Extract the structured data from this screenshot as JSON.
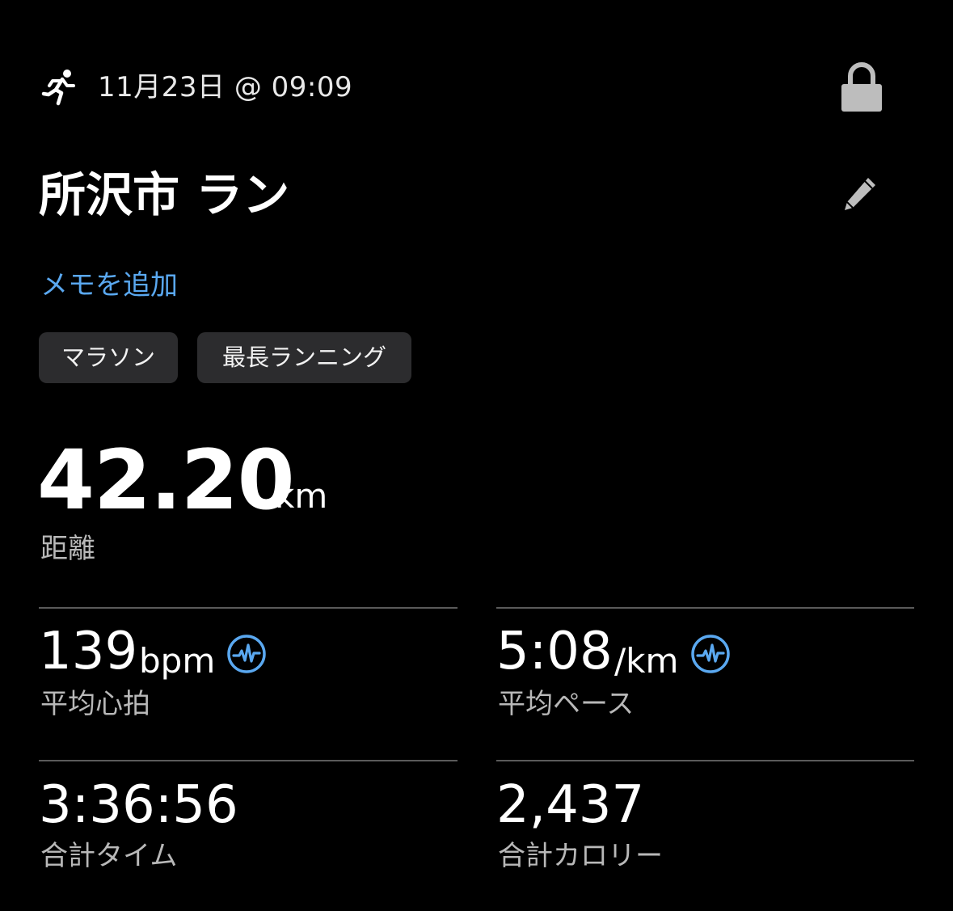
{
  "header": {
    "activity_icon": "running-person-icon",
    "date_time": "11月23日 @ 09:09",
    "privacy_icon": "lock-icon"
  },
  "title": {
    "text": "所沢市 ラン",
    "edit_icon": "pencil-icon"
  },
  "memo": {
    "add_label": "メモを追加"
  },
  "tags": [
    {
      "label": "マラソン"
    },
    {
      "label": "最長ランニング"
    }
  ],
  "distance": {
    "value": "42.20",
    "unit": "km",
    "label": "距離"
  },
  "stats": {
    "heart_rate": {
      "value": "139",
      "unit": "bpm",
      "label": "平均心拍",
      "icon": "heart-rate-pulse-icon"
    },
    "pace": {
      "value": "5:08",
      "unit": "/km",
      "label": "平均ペース",
      "icon": "pace-pulse-icon"
    },
    "total_time": {
      "value": "3:36:56",
      "label": "合計タイム"
    },
    "total_calories": {
      "value": "2,437",
      "label": "合計カロリー"
    }
  },
  "colors": {
    "background": "#000000",
    "accent_link": "#5aa8f0",
    "tag_background": "#2c2c2e",
    "divider": "#5a5a5a",
    "secondary_text": "#b8b8b8",
    "icon_gray": "#bdbdbd"
  }
}
